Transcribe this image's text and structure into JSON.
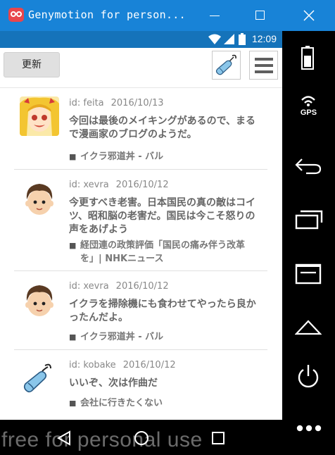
{
  "window": {
    "title": "Genymotion for person...",
    "controls": [
      "minimize",
      "maximize",
      "close"
    ]
  },
  "status_bar": {
    "time": "12:09",
    "icons": [
      "wifi-icon",
      "signal-icon",
      "battery-icon"
    ]
  },
  "toolbar": {
    "refresh_label": "更新",
    "icons": [
      "mouse-icon",
      "menu-icon"
    ]
  },
  "posts": [
    {
      "user": "id: feita",
      "date": "2016/10/13",
      "text": "今回は最後のメイキングがあるので、まるで漫画家のブログのようだ。",
      "link": "イクラ邪道丼 - バル",
      "avatar": "anime-girl-avatar"
    },
    {
      "user": "id: xevra",
      "date": "2016/10/12",
      "text": "今更すべき老害。日本国民の真の敵はコイツ、昭和脳の老害だ。国民は今こそ怒りの声をあげよう",
      "link": "経団連の政策評価「国民の痛み伴う改革を」| NHKニュース",
      "avatar": "boy-avatar"
    },
    {
      "user": "id: xevra",
      "date": "2016/10/12",
      "text": "イクラを掃除機にも食わせてやったら良かったんだよ。",
      "link": "イクラ邪道丼 - バル",
      "avatar": "boy-avatar"
    },
    {
      "user": "id: kobake",
      "date": "2016/10/12",
      "text": "いいぞ、次は作曲だ",
      "link": "会社に行きたくない",
      "avatar": "mouse-avatar"
    }
  ],
  "watermark": "free for personal use",
  "nav_bar": [
    "back-icon",
    "home-icon",
    "recents-icon"
  ],
  "sidebar": {
    "gps_label": "GPS",
    "buttons": [
      "battery-icon",
      "gps-icon",
      "back-icon",
      "recents-icon",
      "menu-icon",
      "home-icon",
      "power-icon",
      "more-icon"
    ]
  },
  "colors": {
    "title_bar": "#1883d7",
    "status_bar": "#1573ba",
    "logo": "#e8464c"
  }
}
